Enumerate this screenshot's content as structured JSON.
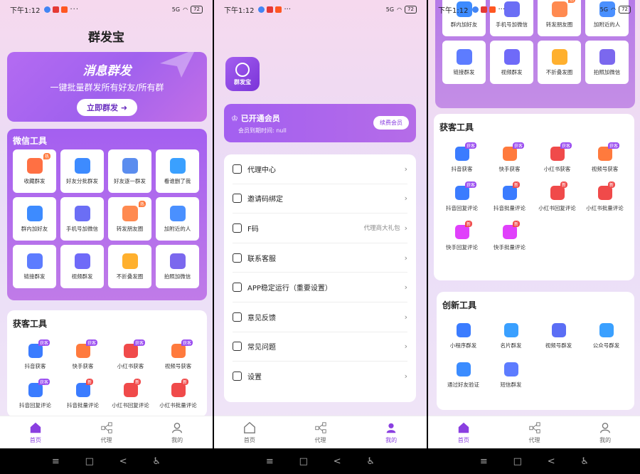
{
  "status": {
    "time": "下午1:12",
    "signal": "5G",
    "battery": "72"
  },
  "nav": [
    {
      "label": "首页",
      "icon": "home-icon"
    },
    {
      "label": "代理",
      "icon": "share-nodes-icon"
    },
    {
      "label": "我的",
      "icon": "person-icon"
    }
  ],
  "sysbar": [
    "≡",
    "□",
    "<",
    "♿"
  ],
  "home": {
    "title": "群发宝",
    "banner": {
      "title": "消息群发",
      "subtitle": "一键批量群发所有好友/所有群",
      "button": "立即群发"
    },
    "wechat_tools": {
      "title": "微信工具",
      "items": [
        {
          "label": "收藏群发",
          "tag": "热",
          "color": "#ff7043"
        },
        {
          "label": "好友分批群发",
          "tag": "",
          "color": "#3d8bff"
        },
        {
          "label": "好友逐一群发",
          "tag": "",
          "color": "#5b8def"
        },
        {
          "label": "看谁删了我",
          "tag": "",
          "color": "#3aa0ff"
        },
        {
          "label": "群内加好友",
          "tag": "",
          "color": "#3d8bff"
        },
        {
          "label": "手机号加微信",
          "tag": "",
          "color": "#6b6ef5"
        },
        {
          "label": "转发朋友圈",
          "tag": "热",
          "color": "#ff8a50"
        },
        {
          "label": "加附近的人",
          "tag": "",
          "color": "#4a90ff"
        },
        {
          "label": "链接群发",
          "tag": "",
          "color": "#5d7cff"
        },
        {
          "label": "视频群发",
          "tag": "",
          "color": "#6f6af8"
        },
        {
          "label": "不折叠发圈",
          "tag": "",
          "color": "#ffb02e"
        },
        {
          "label": "拍照加微信",
          "tag": "",
          "color": "#7b68ee"
        }
      ]
    },
    "acquire_tools": {
      "title": "获客工具",
      "items": [
        {
          "label": "抖音获客",
          "tag": "获客",
          "color": "#3b7cff"
        },
        {
          "label": "快手获客",
          "tag": "获客",
          "color": "#ff7a3d"
        },
        {
          "label": "小红书获客",
          "tag": "获客",
          "color": "#f04a4a"
        },
        {
          "label": "视频号获客",
          "tag": "获客",
          "color": "#ff7a3d"
        },
        {
          "label": "抖音回复评论",
          "tag": "获客",
          "color": "#3b7cff"
        },
        {
          "label": "抖音批量评论",
          "tag": "新",
          "color": "#3b7cff"
        },
        {
          "label": "小红书回复评论",
          "tag": "新",
          "color": "#f04a4a"
        },
        {
          "label": "小红书批量评论",
          "tag": "新",
          "color": "#f04a4a"
        }
      ]
    }
  },
  "mine": {
    "app_name": "群发宝",
    "member": {
      "title": "已开通会员",
      "expire": "会员到期时间: null",
      "button": "续费会员"
    },
    "menu": [
      {
        "label": "代理中心",
        "value": ""
      },
      {
        "label": "邀请码绑定",
        "value": ""
      },
      {
        "label": "F码",
        "value": "代理商大礼包"
      },
      {
        "label": "联系客服",
        "value": ""
      },
      {
        "label": "APP稳定运行（重要设置）",
        "value": ""
      },
      {
        "label": "意见反馈",
        "value": ""
      },
      {
        "label": "常见问题",
        "value": ""
      },
      {
        "label": "设置",
        "value": ""
      }
    ]
  },
  "scrolled": {
    "wechat_tail": [
      {
        "label": "群内加好友",
        "color": "#3d8bff"
      },
      {
        "label": "手机号加微信",
        "color": "#6b6ef5"
      },
      {
        "label": "转发朋友圈",
        "color": "#ff8a50",
        "tag": "热"
      },
      {
        "label": "加附近的人",
        "color": "#4a90ff"
      },
      {
        "label": "链接群发",
        "color": "#5d7cff"
      },
      {
        "label": "视频群发",
        "color": "#6f6af8"
      },
      {
        "label": "不折叠发圈",
        "color": "#ffb02e"
      },
      {
        "label": "拍照加微信",
        "color": "#7b68ee"
      }
    ],
    "acquire_tools": {
      "title": "获客工具",
      "items": [
        {
          "label": "抖音获客",
          "tag": "获客",
          "color": "#3b7cff"
        },
        {
          "label": "快手获客",
          "tag": "获客",
          "color": "#ff7a3d"
        },
        {
          "label": "小红书获客",
          "tag": "获客",
          "color": "#f04a4a"
        },
        {
          "label": "视频号获客",
          "tag": "获客",
          "color": "#ff7a3d"
        },
        {
          "label": "抖音回复评论",
          "tag": "获客",
          "color": "#3b7cff"
        },
        {
          "label": "抖音批量评论",
          "tag": "新",
          "color": "#3b7cff"
        },
        {
          "label": "小红书回复评论",
          "tag": "新",
          "color": "#f04a4a"
        },
        {
          "label": "小红书批量评论",
          "tag": "新",
          "color": "#f04a4a"
        },
        {
          "label": "快手回复评论",
          "tag": "新",
          "color": "#e040fb"
        },
        {
          "label": "快手批量评论",
          "tag": "新",
          "color": "#e040fb"
        }
      ]
    },
    "innovation_tools": {
      "title": "创新工具",
      "items": [
        {
          "label": "小程序群发",
          "color": "#3b7cff"
        },
        {
          "label": "名片群发",
          "color": "#3aa0ff"
        },
        {
          "label": "视频号群发",
          "color": "#5b6ef5"
        },
        {
          "label": "公众号群发",
          "color": "#3aa0ff"
        },
        {
          "label": "通过好友验证",
          "color": "#3b8cff"
        },
        {
          "label": "短信群发",
          "color": "#5d7cff"
        }
      ]
    }
  }
}
